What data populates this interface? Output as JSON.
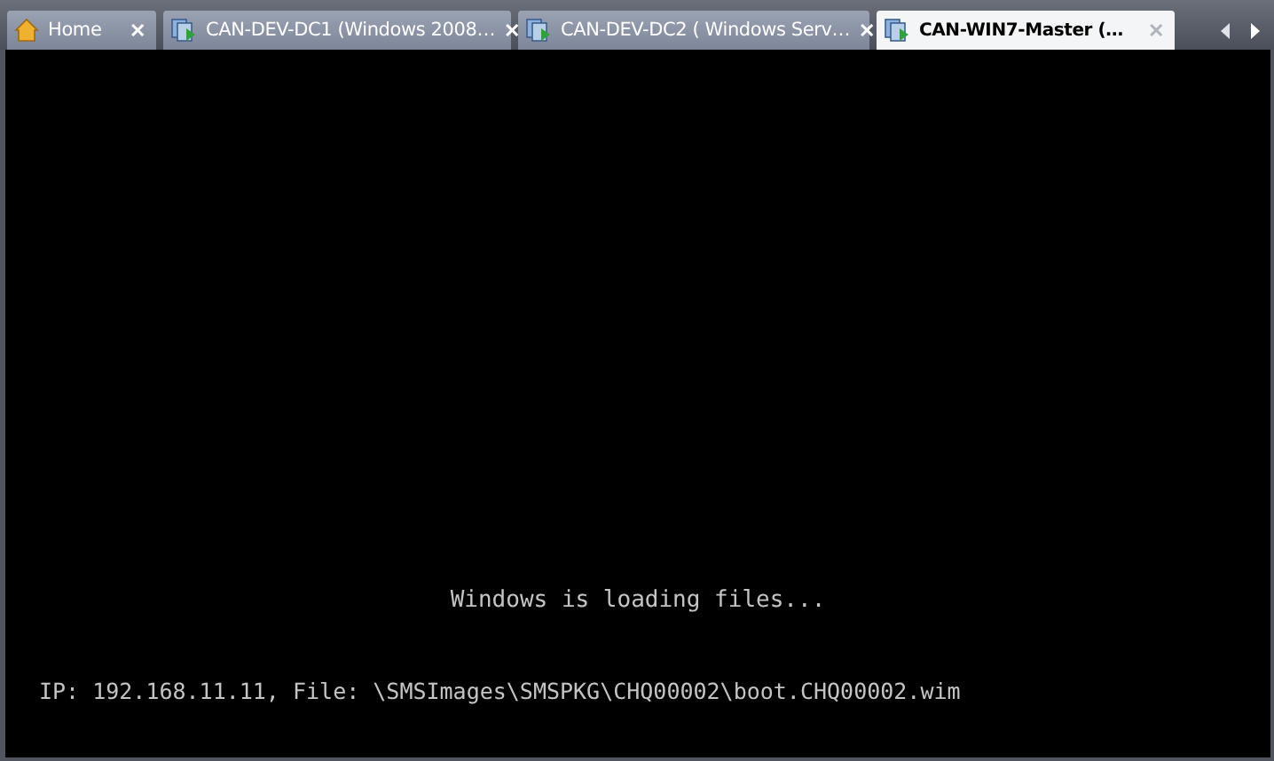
{
  "tabs": [
    {
      "kind": "home",
      "label": "Home",
      "selected": false,
      "close": "✕"
    },
    {
      "kind": "vm",
      "label": "CAN-DEV-DC1 (Windows 2008…",
      "selected": false,
      "close": "✕"
    },
    {
      "kind": "vm",
      "label": "CAN-DEV-DC2 ( Windows Serv…",
      "selected": false,
      "close": "✕"
    },
    {
      "kind": "vm",
      "label": "CAN-WIN7-Master (…",
      "selected": true,
      "close": "✕"
    }
  ],
  "console": {
    "status": "Windows is loading files...",
    "detail": "IP: 192.168.11.11, File: \\SMSImages\\SMSPKG\\CHQ00002\\boot.CHQ00002.wim"
  }
}
